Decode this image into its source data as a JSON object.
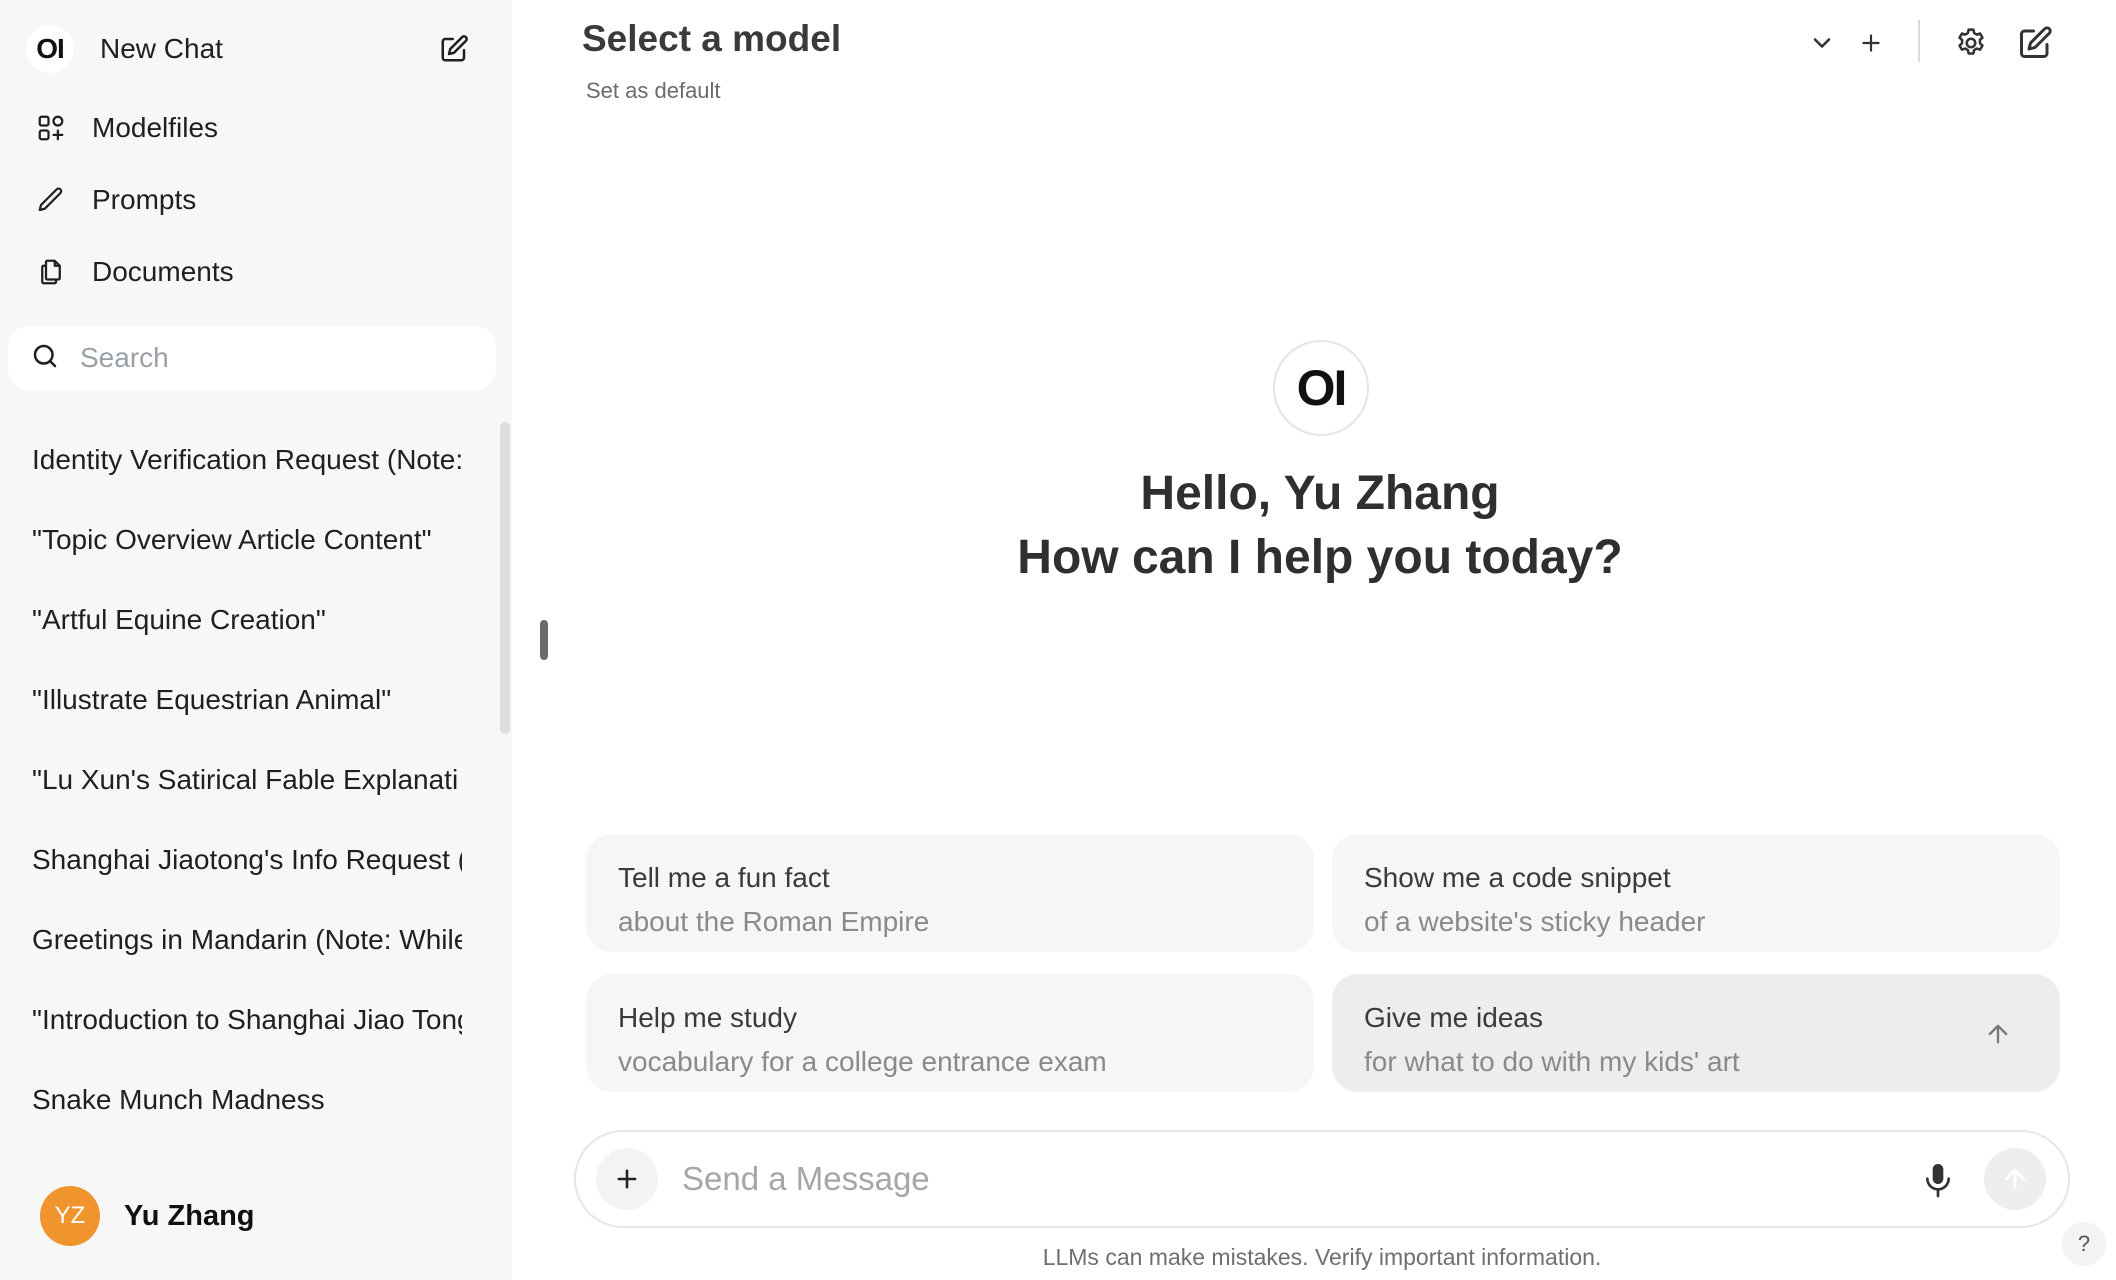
{
  "sidebar": {
    "logo_text": "OI",
    "new_chat_label": "New Chat",
    "nav": [
      {
        "label": "Modelfiles",
        "icon": "modelfiles-icon"
      },
      {
        "label": "Prompts",
        "icon": "pencil-icon"
      },
      {
        "label": "Documents",
        "icon": "documents-icon"
      }
    ],
    "search": {
      "placeholder": "Search"
    },
    "chats": [
      "Identity Verification Request (Note:",
      "\"Topic Overview Article Content\"",
      "\"Artful Equine Creation\"",
      "\"Illustrate Equestrian Animal\"",
      "\"Lu Xun's Satirical Fable Explanati",
      "Shanghai Jiaotong's Info Request (",
      "Greetings in Mandarin (Note: While",
      "\"Introduction to Shanghai Jiao Tong",
      "Snake Munch Madness"
    ],
    "user": {
      "initials": "YZ",
      "name": "Yu Zhang",
      "avatar_color": "#f0952e"
    }
  },
  "header": {
    "title": "Select a model",
    "set_default": "Set as default"
  },
  "hero": {
    "logo_text": "OI",
    "line1": "Hello, Yu Zhang",
    "line2": "How can I help you today?"
  },
  "suggestions": [
    {
      "title": "Tell me a fun fact",
      "subtitle": "about the Roman Empire"
    },
    {
      "title": "Show me a code snippet",
      "subtitle": "of a website's sticky header"
    },
    {
      "title": "Help me study",
      "subtitle": "vocabulary for a college entrance exam"
    },
    {
      "title": "Give me ideas",
      "subtitle": "for what to do with my kids' art"
    }
  ],
  "composer": {
    "placeholder": "Send a Message"
  },
  "disclaimer": "LLMs can make mistakes. Verify important information.",
  "help_label": "?"
}
